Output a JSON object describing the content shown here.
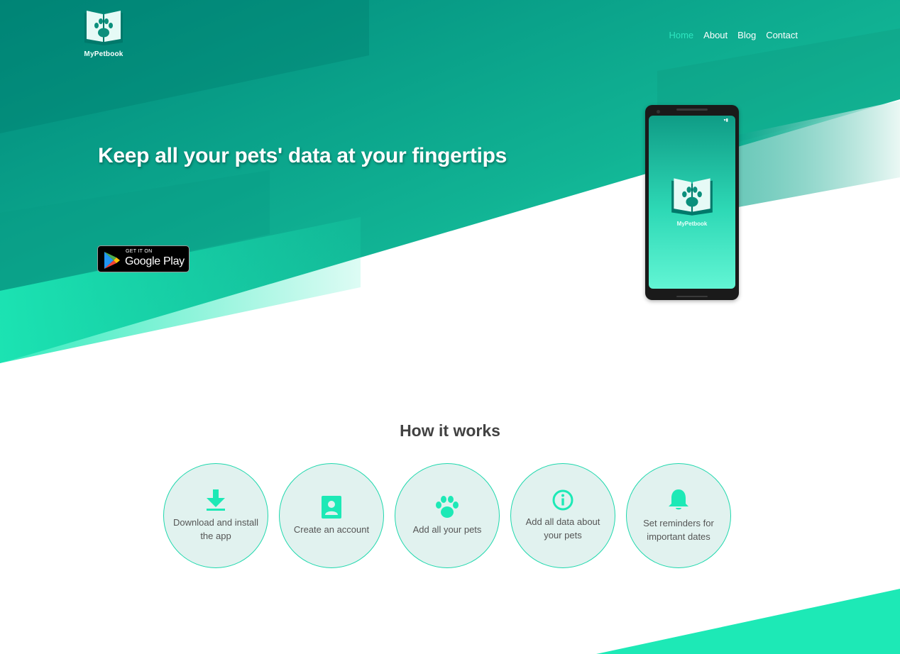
{
  "brand": {
    "prefix": "My",
    "name": "Petbook"
  },
  "nav": {
    "items": [
      "Home",
      "About",
      "Blog",
      "Contact"
    ],
    "active": "Home"
  },
  "hero": {
    "headline": "Keep all your pets' data at your fingertips",
    "store_badge": {
      "small": "GET IT ON",
      "big": "Google Play"
    }
  },
  "phone": {
    "app_name_prefix": "My",
    "app_name": "Petbook",
    "status": "▾▮"
  },
  "how": {
    "title": "How it works",
    "steps": [
      {
        "icon": "download-icon",
        "label": "Download and install the app"
      },
      {
        "icon": "account-icon",
        "label": "Create an account"
      },
      {
        "icon": "paw-icon",
        "label": "Add all your pets"
      },
      {
        "icon": "info-icon",
        "label": "Add all data about your pets"
      },
      {
        "icon": "bell-icon",
        "label": "Set reminders for important dates"
      }
    ]
  },
  "colors": {
    "accent": "#1de9b6",
    "teal_dark": "#00897b",
    "text_dark": "#424242",
    "circle_bg": "#e1f2ef"
  }
}
